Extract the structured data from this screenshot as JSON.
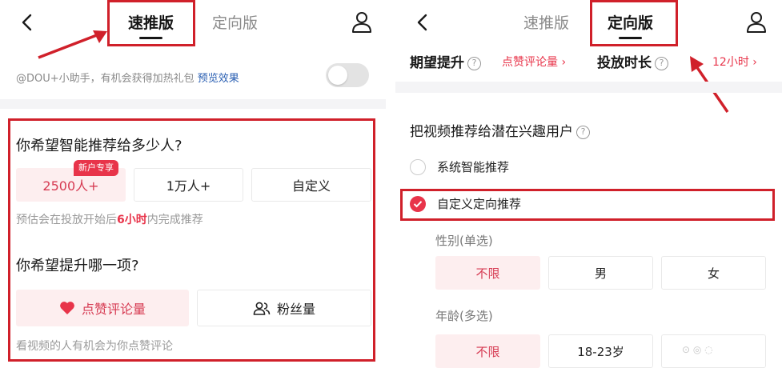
{
  "left": {
    "tabs": [
      {
        "label": "速推版",
        "active": true
      },
      {
        "label": "定向版",
        "active": false
      }
    ],
    "promo": {
      "text": "@DOU+小助手，有机会获得加热礼包 ",
      "link": "预览效果"
    },
    "toggle_on": false,
    "q1": "你希望智能推荐给多少人?",
    "reach_options": [
      {
        "label": "2500人+",
        "selected": true,
        "badge": "新户专享"
      },
      {
        "label": "1万人+",
        "selected": false
      },
      {
        "label": "自定义",
        "selected": false
      }
    ],
    "hint1": {
      "pre": "预估会在投放开始后",
      "emph": "6小时",
      "post": "内完成推荐"
    },
    "q2": "你希望提升哪一项?",
    "goal_options": [
      {
        "label": "点赞评论量",
        "selected": true,
        "icon": "heart-icon"
      },
      {
        "label": "粉丝量",
        "selected": false,
        "icon": "users-icon"
      }
    ],
    "hint2": "看视频的人有机会为你点赞评论"
  },
  "right": {
    "tabs": [
      {
        "label": "速推版",
        "active": false
      },
      {
        "label": "定向版",
        "active": true
      }
    ],
    "expect_label": "期望提升",
    "expect_value": "点赞评论量 ›",
    "duration_label": "投放时长",
    "duration_value": "12小时 ›",
    "section_title": "把视频推荐给潜在兴趣用户",
    "radio_options": [
      {
        "label": "系统智能推荐",
        "checked": false
      },
      {
        "label": "自定义定向推荐",
        "checked": true
      }
    ],
    "gender_label": "性别(单选)",
    "gender_options": [
      {
        "label": "不限",
        "selected": true
      },
      {
        "label": "男",
        "selected": false
      },
      {
        "label": "女",
        "selected": false
      }
    ],
    "age_label": "年龄(多选)",
    "age_options": [
      {
        "label": "不限",
        "selected": true
      },
      {
        "label": "18-23岁",
        "selected": false
      }
    ]
  },
  "colors": {
    "accent": "#e8344a",
    "annotation": "#d0202a",
    "selected_bg": "#fdeeef"
  }
}
